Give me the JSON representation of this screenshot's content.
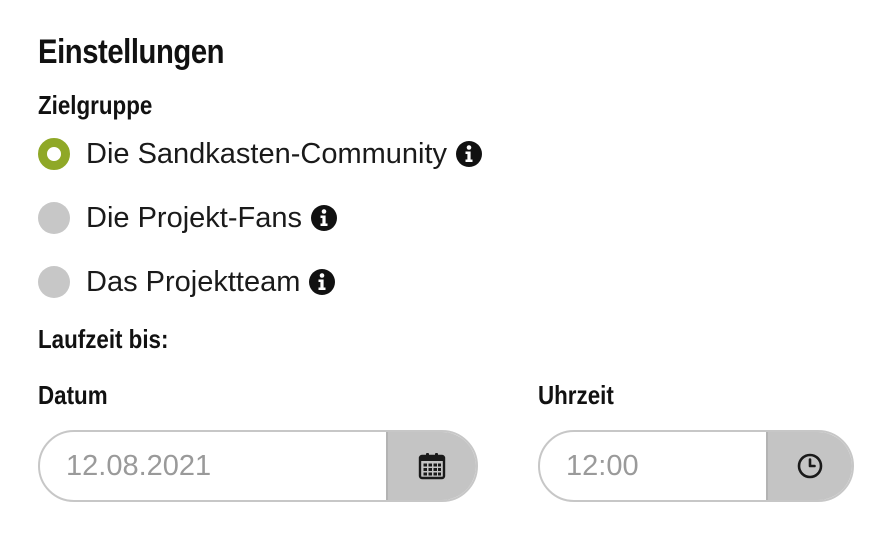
{
  "settings": {
    "title": "Einstellungen",
    "target_group": {
      "label": "Zielgruppe",
      "options": [
        {
          "label": "Die Sandkasten-Community",
          "selected": true
        },
        {
          "label": "Die Projekt-Fans",
          "selected": false
        },
        {
          "label": "Das Projektteam",
          "selected": false
        }
      ]
    },
    "runtime": {
      "label": "Laufzeit bis:",
      "date": {
        "label": "Datum",
        "value": "12.08.2021",
        "icon": "calendar-icon"
      },
      "time": {
        "label": "Uhrzeit",
        "value": "12:00",
        "icon": "clock-icon"
      }
    }
  },
  "colors": {
    "accent": "#8fa827",
    "radio_unselected": "#c7c7c7",
    "field_border": "#c7c7c7",
    "field_button": "#c4c4c4",
    "placeholder_text": "#9a9a9a"
  }
}
